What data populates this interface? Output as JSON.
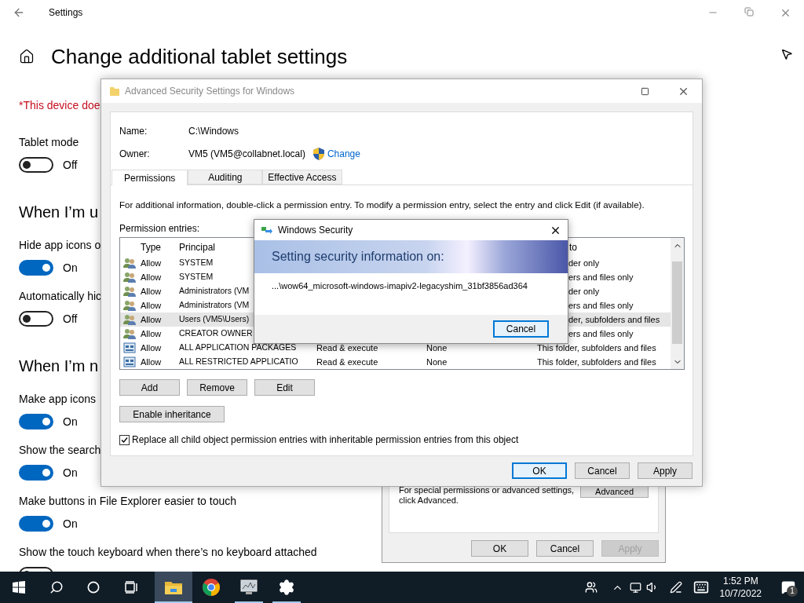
{
  "settings_window": {
    "title": "Settings",
    "page_title": "Change additional tablet settings",
    "items": [
      {
        "kind": "warning",
        "text": "*This device doe"
      },
      {
        "kind": "toggle",
        "label": "Tablet mode",
        "on": false,
        "state": "Off"
      },
      {
        "kind": "heading",
        "text": "When I’m u"
      },
      {
        "kind": "toggle",
        "label": "Hide app icons o",
        "on": true,
        "state": "On"
      },
      {
        "kind": "toggle",
        "label": "Automatically hic",
        "on": false,
        "state": "Off"
      },
      {
        "kind": "heading",
        "text": "When I’m n"
      },
      {
        "kind": "toggle",
        "label": "Make app icons",
        "on": true,
        "state": "On"
      },
      {
        "kind": "toggle",
        "label": "Show the search",
        "on": true,
        "state": "On"
      },
      {
        "kind": "toggle",
        "label": "Make buttons in File Explorer easier to touch",
        "on": true,
        "state": "On"
      },
      {
        "kind": "toggle",
        "label": "Show the touch keyboard when there’s no keyboard attached",
        "on": false
      }
    ]
  },
  "properties_dialog": {
    "note": "For special permissions or advanced settings, click Advanced.",
    "advanced_button": "Advanced",
    "buttons": [
      {
        "label": "OK",
        "disabled": false
      },
      {
        "label": "Cancel",
        "disabled": false
      },
      {
        "label": "Apply",
        "disabled": true
      }
    ]
  },
  "advanced_security": {
    "title": "Advanced Security Settings for Windows",
    "fields": [
      {
        "label": "Name:",
        "value": "C:\\Windows"
      },
      {
        "label": "Owner:",
        "value": "VM5 (VM5@collabnet.local)",
        "link": "Change"
      }
    ],
    "tabs": [
      {
        "label": "Permissions",
        "selected": true
      },
      {
        "label": "Auditing",
        "selected": false
      },
      {
        "label": "Effective Access",
        "selected": false
      }
    ],
    "info": "For additional information, double-click a permission entry. To modify a permission entry, select the entry and click Edit (if available).",
    "entries_label": "Permission entries:",
    "table": {
      "columns": [
        "Type",
        "Principal",
        "to"
      ],
      "rows": [
        {
          "kind": "users",
          "type": "Allow",
          "principal": "SYSTEM",
          "applies_to": "der only",
          "selected": false
        },
        {
          "kind": "users",
          "type": "Allow",
          "principal": "SYSTEM",
          "applies_to": "ers and files only",
          "selected": false
        },
        {
          "kind": "users",
          "type": "Allow",
          "principal": "Administrators (VM",
          "applies_to": "der only",
          "selected": false
        },
        {
          "kind": "users",
          "type": "Allow",
          "principal": "Administrators (VM",
          "applies_to": "ers and files only",
          "selected": false
        },
        {
          "kind": "users",
          "type": "Allow",
          "principal": "Users (VM5\\Users)",
          "applies_to": "der, subfolders and files",
          "selected": true
        },
        {
          "kind": "users",
          "type": "Allow",
          "principal": "CREATOR OWNER",
          "applies_to": "ers and files only",
          "selected": false
        },
        {
          "kind": "package",
          "type": "Allow",
          "principal": "ALL APPLICATION PACKAGES",
          "access": "Read & execute",
          "inherited": "None",
          "applies_to": "This folder, subfolders and files",
          "selected": false
        },
        {
          "kind": "package",
          "type": "Allow",
          "principal": "ALL RESTRICTED APPLICATIO",
          "access": "Read & execute",
          "inherited": "None",
          "applies_to": "This folder, subfolders and files",
          "selected": false
        }
      ]
    },
    "entry_buttons": [
      "Add",
      "Remove",
      "Edit"
    ],
    "inheritance_button": "Enable inheritance",
    "replace_checkbox": {
      "label": "Replace all child object permission entries with inheritable permission entries from this object",
      "checked": true
    },
    "buttons": [
      {
        "label": "OK",
        "default": true
      },
      {
        "label": "Cancel",
        "default": false
      },
      {
        "label": "Apply",
        "default": false
      }
    ]
  },
  "security_dialog": {
    "title": "Windows Security",
    "banner": "Setting security information on:",
    "path": "...\\wow64_microsoft-windows-imapiv2-legacyshim_31bf3856ad364",
    "button": "Cancel"
  },
  "taskbar": {
    "apps": [
      {
        "kind": "explorer",
        "open": true,
        "active": true
      },
      {
        "kind": "chrome",
        "open": false,
        "active": false
      },
      {
        "kind": "monitor",
        "open": true,
        "active": false
      },
      {
        "kind": "settings",
        "open": true,
        "active": false
      }
    ],
    "time": "1:52 PM",
    "date": "10/7/2022",
    "notifications": "1"
  }
}
